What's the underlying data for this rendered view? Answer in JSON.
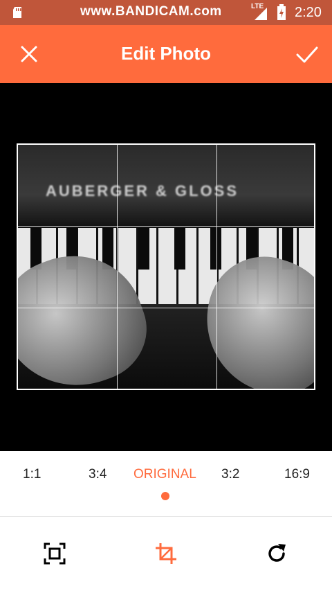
{
  "status_bar": {
    "watermark": "www.BANDICAM.com",
    "network": "LTE",
    "time": "2:20"
  },
  "toolbar": {
    "title": "Edit Photo",
    "close_icon": "close-icon",
    "confirm_icon": "check-icon"
  },
  "photo": {
    "brand_text": "AUBERGER & GLOSS"
  },
  "ratios": [
    "1:1",
    "3:4",
    "ORIGINAL",
    "3:2",
    "16:9"
  ],
  "selected_ratio": "ORIGINAL",
  "tools": {
    "fit": "fit-frame-icon",
    "crop": "crop-icon",
    "rotate": "rotate-icon"
  },
  "colors": {
    "accent": "#ff6b3d",
    "status_bar": "#c0563a"
  }
}
